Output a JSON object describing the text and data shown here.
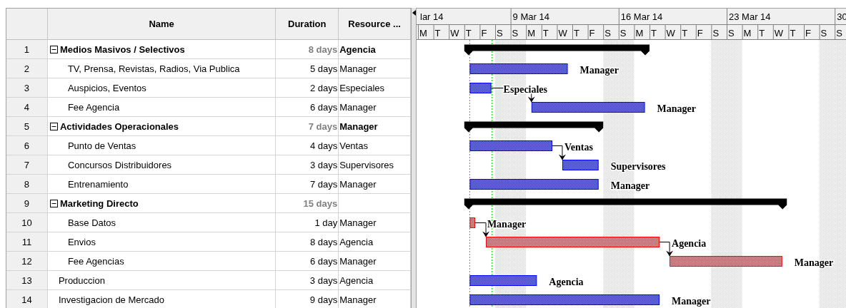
{
  "table": {
    "columns": [
      "Name",
      "Duration",
      "Resource ..."
    ]
  },
  "tasks": [
    {
      "id": "1",
      "name": "Medios Masivos / Selectivos",
      "duration": "8 days",
      "resource": "Agencia",
      "kind": "summary",
      "expanded": true,
      "children": [
        {
          "id": "2",
          "name": "TV, Prensa, Revistas, Radios, Via Publica",
          "duration": "5 days",
          "resource": "Manager",
          "kind": "task",
          "bar_label": "Manager",
          "linked": false
        },
        {
          "id": "3",
          "name": "Auspicios, Eventos",
          "duration": "2 days",
          "resource": "Especiales",
          "kind": "task",
          "bar_label": "Especiales",
          "linked": false
        },
        {
          "id": "4",
          "name": "Fee Agencia",
          "duration": "6 days",
          "resource": "Manager",
          "kind": "task",
          "bar_label": "Manager",
          "linked": true
        }
      ]
    },
    {
      "id": "5",
      "name": "Actividades Operacionales",
      "duration": "7 days",
      "resource": "Manager",
      "kind": "summary",
      "expanded": true,
      "children": [
        {
          "id": "6",
          "name": "Punto de Ventas",
          "duration": "4 days",
          "resource": "Ventas",
          "kind": "task",
          "bar_label": "Ventas",
          "linked": false
        },
        {
          "id": "7",
          "name": "Concursos Distribuidores",
          "duration": "3 days",
          "resource": "Supervisores",
          "kind": "task",
          "bar_label": "Supervisores",
          "linked": true
        },
        {
          "id": "8",
          "name": "Entrenamiento",
          "duration": "7 days",
          "resource": "Manager",
          "kind": "task",
          "bar_label": "Manager",
          "linked": false
        }
      ]
    },
    {
      "id": "9",
      "name": "Marketing Directo",
      "duration": "15 days",
      "kind": "summary",
      "expanded": true,
      "children": [
        {
          "id": "10",
          "name": "Base Datos",
          "duration": "1 day",
          "resource": "Manager",
          "kind": "critical",
          "bar_label": "Manager",
          "linked": false
        },
        {
          "id": "11",
          "name": "Envios",
          "duration": "8 days",
          "resource": "Agencia",
          "kind": "critical",
          "bar_label": "Agencia",
          "linked": true
        },
        {
          "id": "12",
          "name": "Fee Agencias",
          "duration": "6 days",
          "resource": "Manager",
          "kind": "critical",
          "bar_label": "Manager",
          "linked": true
        }
      ]
    },
    {
      "id": "13",
      "name": "Produccion",
      "duration": "3 days",
      "resource": "Agencia",
      "kind": "task",
      "bar_label": "Agencia",
      "linked": false
    },
    {
      "id": "14",
      "name": "Investigacion de Mercado",
      "duration": "9 days",
      "resource": "Manager",
      "kind": "task",
      "bar_label": "Manager",
      "linked": false
    }
  ],
  "gantt": {
    "timescale": {
      "weeks": [
        "lar 14",
        "9 Mar 14",
        "16 Mar 14",
        "23 Mar 14",
        "30"
      ],
      "days": [
        {
          "letter": "M",
          "weekend": false
        },
        {
          "letter": "T",
          "weekend": false
        },
        {
          "letter": "W",
          "weekend": false
        },
        {
          "letter": "T",
          "weekend": false
        },
        {
          "letter": "F",
          "weekend": false
        },
        {
          "letter": "S",
          "weekend": true
        },
        {
          "letter": "S",
          "weekend": true
        },
        {
          "letter": "M",
          "weekend": false
        },
        {
          "letter": "T",
          "weekend": false
        },
        {
          "letter": "W",
          "weekend": false
        },
        {
          "letter": "T",
          "weekend": false
        },
        {
          "letter": "F",
          "weekend": false
        },
        {
          "letter": "S",
          "weekend": true
        },
        {
          "letter": "S",
          "weekend": true
        },
        {
          "letter": "M",
          "weekend": false
        },
        {
          "letter": "T",
          "weekend": false
        },
        {
          "letter": "W",
          "weekend": false
        },
        {
          "letter": "T",
          "weekend": false
        },
        {
          "letter": "F",
          "weekend": false
        },
        {
          "letter": "S",
          "weekend": true
        },
        {
          "letter": "S",
          "weekend": true
        },
        {
          "letter": "M",
          "weekend": false
        },
        {
          "letter": "T",
          "weekend": false
        },
        {
          "letter": "W",
          "weekend": false
        },
        {
          "letter": "T",
          "weekend": false
        },
        {
          "letter": "F",
          "weekend": false
        },
        {
          "letter": "S",
          "weekend": true
        },
        {
          "letter": "S",
          "weekend": true
        }
      ]
    }
  }
}
